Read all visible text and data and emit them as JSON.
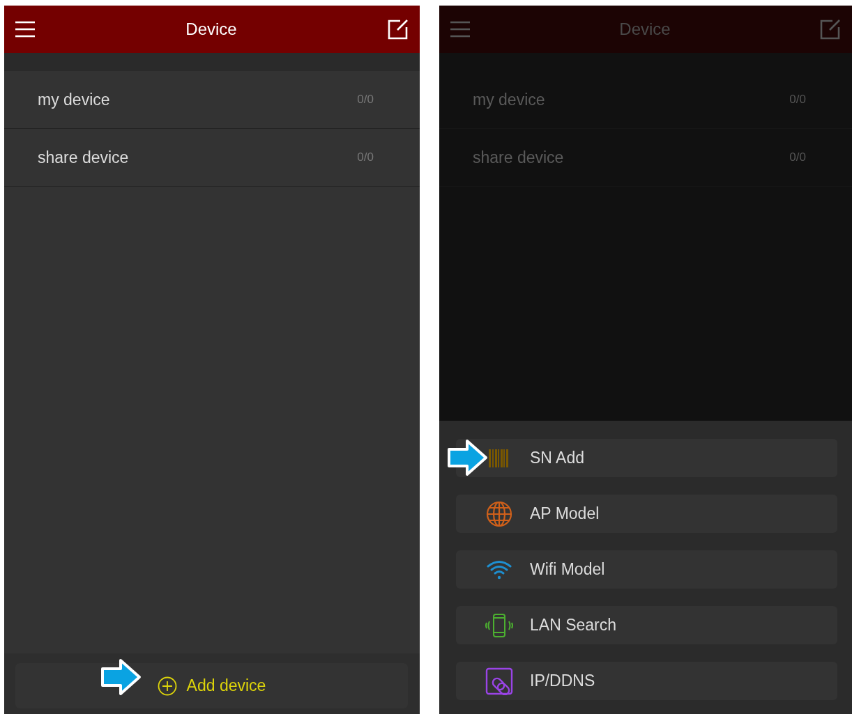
{
  "screens": [
    {
      "dimmed": false,
      "header": {
        "title": "Device"
      },
      "groups": [
        {
          "name": "my device",
          "count": "0/0"
        },
        {
          "name": "share device",
          "count": "0/0"
        }
      ],
      "add_button": {
        "label": "Add device"
      }
    },
    {
      "dimmed": true,
      "header": {
        "title": "Device"
      },
      "groups": [
        {
          "name": "my device",
          "count": "0/0"
        },
        {
          "name": "share device",
          "count": "0/0"
        }
      ],
      "sheet": {
        "items": [
          {
            "kind": "barcode",
            "label": "SN Add"
          },
          {
            "kind": "globe",
            "label": "AP Model"
          },
          {
            "kind": "wifi",
            "label": "Wifi Model"
          },
          {
            "kind": "phone",
            "label": "LAN Search"
          },
          {
            "kind": "link",
            "label": "IP/DDNS"
          }
        ]
      }
    }
  ]
}
